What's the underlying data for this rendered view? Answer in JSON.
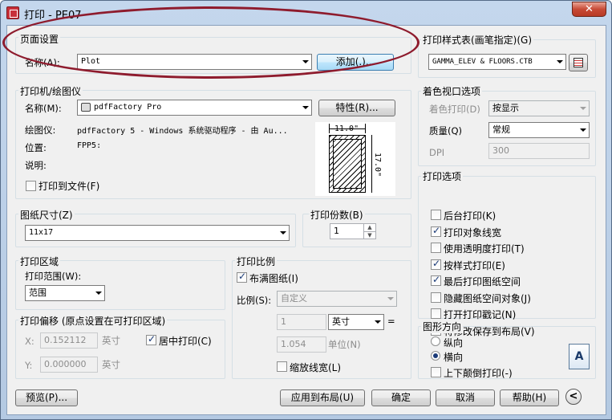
{
  "window": {
    "title": "打印 - PE07",
    "close": "✕"
  },
  "page_setup": {
    "group": "页面设置",
    "name_label": "名称(A):",
    "name_value": "Plot",
    "add_button": "添加(.)..."
  },
  "plotter": {
    "group": "打印机/绘图仪",
    "name_label": "名称(M):",
    "name_value": "pdfFactory Pro",
    "properties_button": "特性(R)...",
    "device_label": "绘图仪:",
    "device_value": "pdfFactory 5 - Windows 系统驱动程序 - 由 Au...",
    "location_label": "位置:",
    "location_value": "FPP5:",
    "description_label": "说明:",
    "plot_to_file": "打印到文件(F)",
    "preview_width": "11.0\"",
    "preview_height": "17.0\""
  },
  "paper": {
    "group": "图纸尺寸(Z)",
    "value": "11x17"
  },
  "copies": {
    "group": "打印份数(B)",
    "value": "1"
  },
  "area": {
    "group": "打印区域",
    "range_label": "打印范围(W):",
    "range_value": "范围"
  },
  "offset": {
    "group": "打印偏移 (原点设置在可打印区域)",
    "x_label": "X:",
    "x_value": "0.152112",
    "x_unit": "英寸",
    "y_label": "Y:",
    "y_value": "0.000000",
    "y_unit": "英寸",
    "center": "居中打印(C)"
  },
  "scale": {
    "group": "打印比例",
    "fit": "布满图纸(I)",
    "scale_label": "比例(S):",
    "scale_value": "自定义",
    "num_value": "1",
    "unit_value": "英寸",
    "equals": "=",
    "den_value": "1.054",
    "den_unit": "单位(N)",
    "lineweights": "缩放线宽(L)"
  },
  "style_table": {
    "group": "打印样式表(画笔指定)(G)",
    "value": "GAMMA_ELEV & FLOORS.CTB"
  },
  "shaded": {
    "group": "着色视口选项",
    "shade_label": "着色打印(D)",
    "shade_value": "按显示",
    "quality_label": "质量(Q)",
    "quality_value": "常规",
    "dpi_label": "DPI",
    "dpi_value": "300"
  },
  "options": {
    "group": "打印选项",
    "items": [
      {
        "label": "后台打印(K)",
        "checked": false
      },
      {
        "label": "打印对象线宽",
        "checked": true
      },
      {
        "label": "使用透明度打印(T)",
        "checked": false
      },
      {
        "label": "按样式打印(E)",
        "checked": true
      },
      {
        "label": "最后打印图纸空间",
        "checked": true
      },
      {
        "label": "隐藏图纸空间对象(J)",
        "checked": false
      },
      {
        "label": "打开打印戳记(N)",
        "checked": false
      },
      {
        "label": "将修改保存到布局(V)",
        "checked": true
      }
    ]
  },
  "orientation": {
    "group": "图形方向",
    "portrait": "纵向",
    "landscape": "横向",
    "upside_down": "上下颠倒打印(-)",
    "icon_letter": "A"
  },
  "buttons": {
    "preview": "预览(P)...",
    "apply": "应用到布局(U)",
    "ok": "确定",
    "cancel": "取消",
    "help": "帮助(H)",
    "collapse": "<"
  }
}
